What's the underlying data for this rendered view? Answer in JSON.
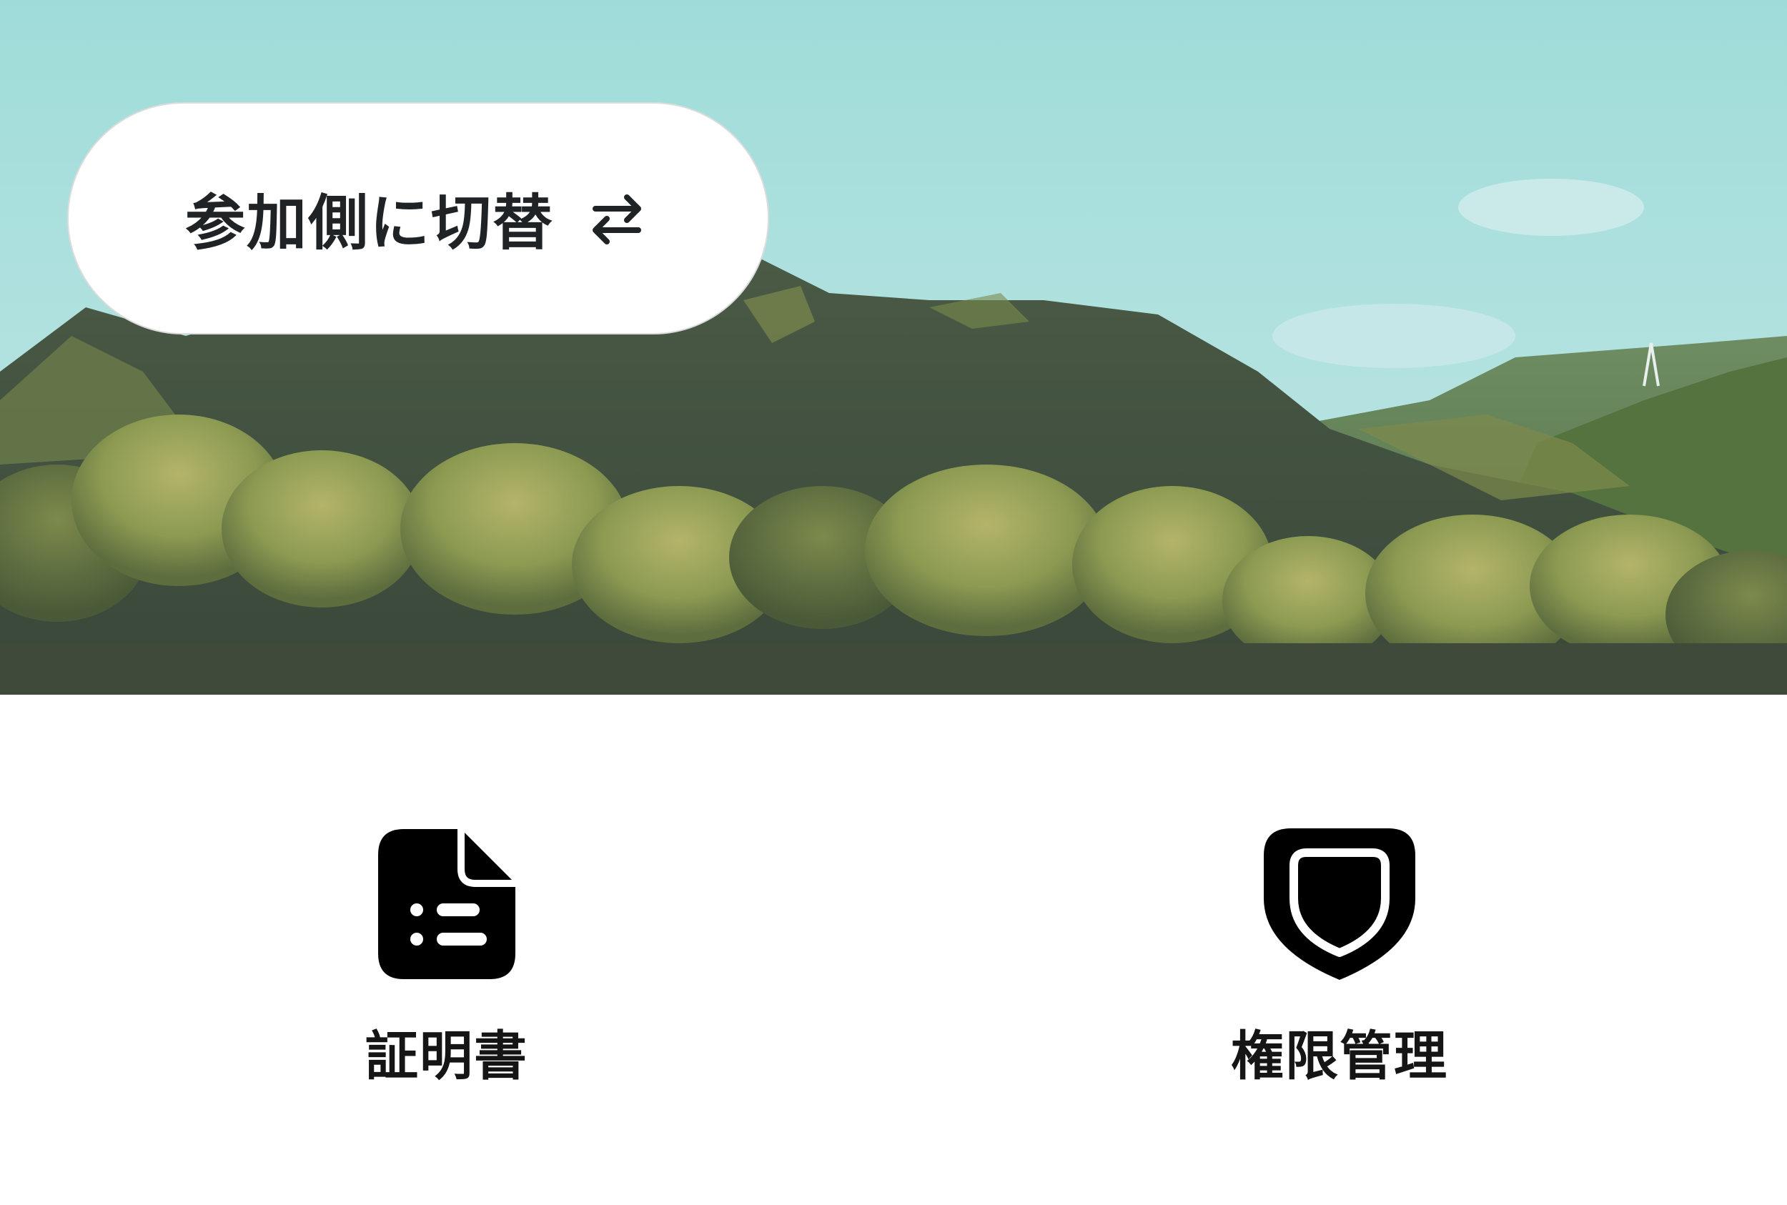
{
  "hero": {
    "switch_button": {
      "label": "参加側に切替",
      "icon": "swap-arrows-icon"
    }
  },
  "menu": {
    "items": [
      {
        "label": "証明書",
        "icon": "document-icon"
      },
      {
        "label": "権限管理",
        "icon": "shield-icon"
      }
    ]
  },
  "colors": {
    "sky_top": "#9fdcd9",
    "forest_dark": "#3c4a3e",
    "foliage_light": "#9aa65a",
    "text_primary": "#151515",
    "button_bg": "#ffffff"
  }
}
